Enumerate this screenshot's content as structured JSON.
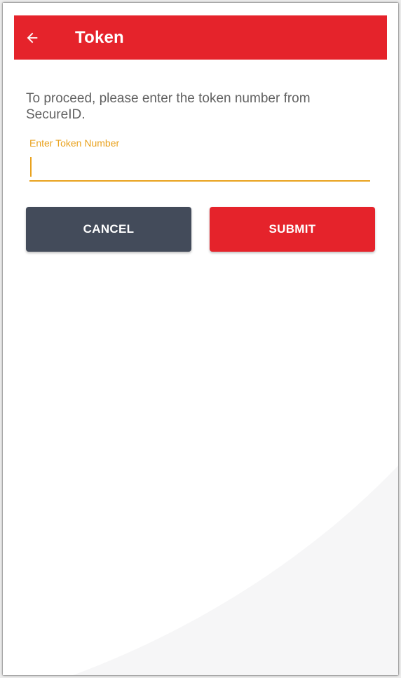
{
  "header": {
    "title": "Token",
    "back_icon": "arrow-back-icon"
  },
  "form": {
    "instruction": "To proceed, please enter the token number from SecureID.",
    "token_label": "Enter Token Number",
    "token_value": ""
  },
  "actions": {
    "cancel_label": "CANCEL",
    "submit_label": "SUBMIT"
  },
  "colors": {
    "brand_red": "#e5232b",
    "cancel_gray": "#434b5a",
    "focus_amber": "#e9a21e",
    "text_gray": "#616161"
  }
}
